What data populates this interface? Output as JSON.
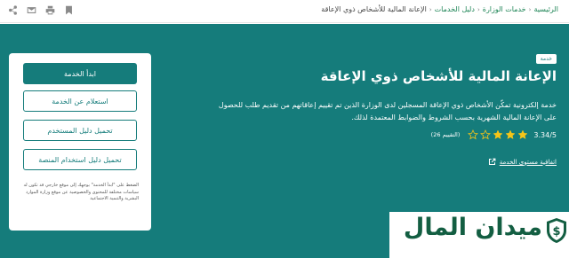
{
  "breadcrumb": {
    "items": [
      "الرئيسية",
      "خدمات الوزارة",
      "دليل الخدمات"
    ],
    "current": "الإعانة المالية للأشخاص ذوي الإعاقة",
    "separator": "‹"
  },
  "top_actions": [
    "share-icon",
    "email-icon",
    "print-icon",
    "bookmark-icon"
  ],
  "service": {
    "tag": "خدمة",
    "title": "الإعانة المالية للأشخاص ذوي الإعاقة",
    "description": "خدمة إلكترونية تمكّن الأشخاص ذوي الإعاقة المسجلين لدى الوزارة الذين تم تقييم إعاقاتهم من تقديم طلب للحصول على الإعانة المالية الشهرية بحسب الشروط والضوابط المعتمدة لذلك.",
    "rating_value": "3.34/5",
    "rating_stars": 3.34,
    "rating_count": "(التقييم 26)",
    "level_link": "اتفاقية مستوى الخدمة"
  },
  "card": {
    "start_button": "ابدأ الخدمة",
    "inquiry_button": "استعلام عن الخدمة",
    "user_guide_button": "تحميل دليل المستخدم",
    "platform_guide_button": "تحميل دليل استخدام المنصة",
    "note": "الضغط على \"ابدأ الخدمة\" يوجهك إلى موقع خارجي قد تكون له سياسات مختلفة للمحتوى والخصوصية عن موقع وزارة الموارد البشرية والتنمية الاجتماعية"
  },
  "watermark": {
    "text": "ميدان المال"
  },
  "colors": {
    "brand": "#157c7b",
    "breadcrumb_link": "#1b8354",
    "star": "#f5c518",
    "watermark": "#135e42"
  }
}
